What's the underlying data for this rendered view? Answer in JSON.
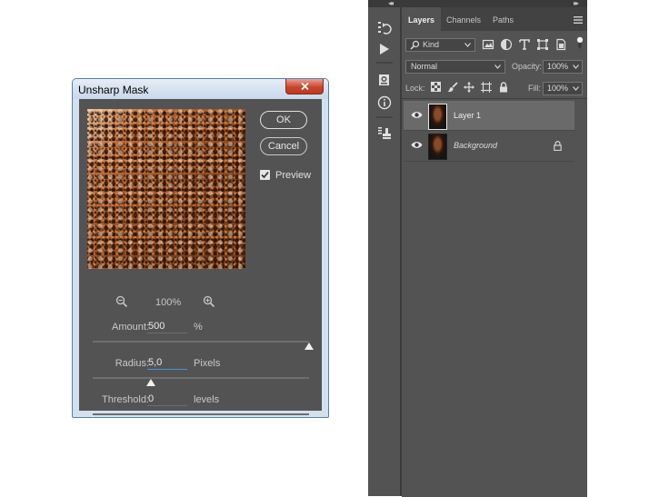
{
  "dialog": {
    "title": "Unsharp Mask",
    "ok_label": "OK",
    "cancel_label": "Cancel",
    "preview_label": "Preview",
    "preview_checked": true,
    "zoom_level": "100%",
    "params": [
      {
        "label": "Amount:",
        "value": "500",
        "unit": "%",
        "slider_fraction": 1.0
      },
      {
        "label": "Radius:",
        "value": "5,0",
        "unit": "Pixels",
        "slider_fraction": 0.27
      },
      {
        "label": "Threshold:",
        "value": "0",
        "unit": "levels",
        "slider_fraction": 0.0
      }
    ]
  },
  "layers_panel": {
    "tabs": [
      {
        "label": "Layers",
        "active": true
      },
      {
        "label": "Channels",
        "active": false
      },
      {
        "label": "Paths",
        "active": false
      }
    ],
    "filter_kind": "Kind",
    "blend_mode": "Normal",
    "opacity_label": "Opacity:",
    "opacity_value": "100%",
    "lock_label": "Lock:",
    "fill_label": "Fill:",
    "fill_value": "100%",
    "layers": [
      {
        "name": "Layer 1",
        "selected": true,
        "locked": false,
        "italic": false
      },
      {
        "name": "Background",
        "selected": false,
        "locked": true,
        "italic": true
      }
    ]
  },
  "colors": {
    "dialog_bg": "#535353",
    "panel_bg": "#535353",
    "selected_row": "#6a6a6a",
    "active_field_underline": "#4d90d6"
  }
}
